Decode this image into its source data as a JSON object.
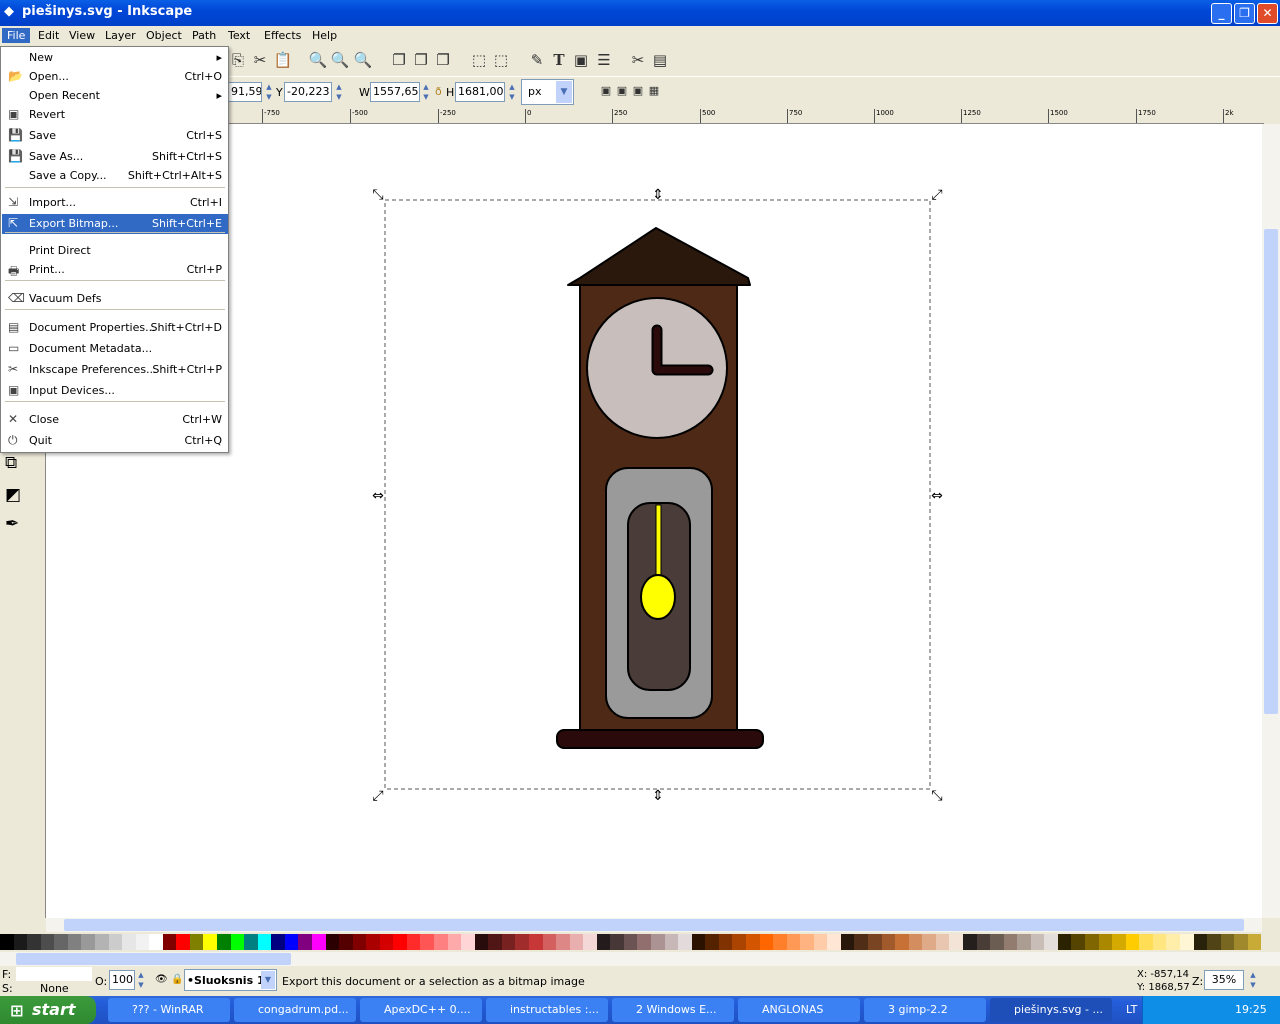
{
  "window": {
    "title": "piešinys.svg - Inkscape",
    "min": "_",
    "max": "❐",
    "close": "✕"
  },
  "menubar": [
    "File",
    "Edit",
    "View",
    "Layer",
    "Object",
    "Path",
    "Text",
    "Effects",
    "Help"
  ],
  "file_menu": [
    {
      "label": "New",
      "shortcut": "",
      "icon": "",
      "submenu": true
    },
    {
      "label": "Open...",
      "shortcut": "Ctrl+O",
      "icon": "folder-icon"
    },
    {
      "label": "Open Recent",
      "shortcut": "",
      "icon": "",
      "submenu": true
    },
    {
      "label": "Revert",
      "shortcut": "",
      "icon": "revert-icon"
    },
    {
      "label": "Save",
      "shortcut": "Ctrl+S",
      "icon": "save-icon"
    },
    {
      "label": "Save As...",
      "shortcut": "Shift+Ctrl+S",
      "icon": "save-as-icon"
    },
    {
      "label": "Save a Copy...",
      "shortcut": "Shift+Ctrl+Alt+S",
      "icon": ""
    },
    {
      "label": "Import...",
      "shortcut": "Ctrl+I",
      "icon": "import-icon"
    },
    {
      "label": "Export Bitmap...",
      "shortcut": "Shift+Ctrl+E",
      "icon": "export-icon",
      "highlighted": true
    },
    {
      "label": "Print Direct",
      "shortcut": "",
      "icon": ""
    },
    {
      "label": "Print...",
      "shortcut": "Ctrl+P",
      "icon": "print-icon"
    },
    {
      "label": "Vacuum Defs",
      "shortcut": "",
      "icon": "vacuum-icon"
    },
    {
      "label": "Document Properties...",
      "shortcut": "Shift+Ctrl+D",
      "icon": "document-properties-icon"
    },
    {
      "label": "Document Metadata...",
      "shortcut": "",
      "icon": "metadata-icon"
    },
    {
      "label": "Inkscape Preferences...",
      "shortcut": "Shift+Ctrl+P",
      "icon": "preferences-icon"
    },
    {
      "label": "Input Devices...",
      "shortcut": "",
      "icon": "input-devices-icon"
    },
    {
      "label": "Close",
      "shortcut": "Ctrl+W",
      "icon": "close-icon"
    },
    {
      "label": "Quit",
      "shortcut": "Ctrl+Q",
      "icon": "quit-icon"
    }
  ],
  "toolcontrols": {
    "x": "91,594",
    "y_label": "Y",
    "y": "-20,223",
    "w_label": "W",
    "w": "1557,655",
    "h_label": "H",
    "h": "1681,003",
    "unit": "px"
  },
  "ruler_ticks": [
    "-750",
    "-500",
    "-250",
    "0",
    "250",
    "500",
    "750",
    "1000",
    "1250",
    "1500",
    "1750",
    "2k"
  ],
  "status": {
    "fill_label": "F:",
    "stroke_label": "S:",
    "stroke_value": "None",
    "opacity_label": "O:",
    "opacity": "100",
    "layer": "•Sluoksnis 1",
    "message": "Export this document or a selection as a bitmap image",
    "cursor_x": "X: -857,14",
    "cursor_y": "Y: 1868,57",
    "zoom_label": "Z:",
    "zoom": "35%"
  },
  "taskbar": {
    "start": "start",
    "tasks": [
      "??? - WinRAR",
      "congadrum.pd...",
      "ApexDC++ 0....",
      "instructables :...",
      "2 Windows E...",
      "ANGLONAS",
      "3 gimp-2.2",
      "piešinys.svg - ..."
    ],
    "lang": "LT",
    "clock": "19:25"
  },
  "drawing_colors": {
    "roof": "#2a180c",
    "body": "#4e2a16",
    "face": "#c8bebb",
    "hands": "#2a0a0a",
    "case": "#9a9a9a",
    "inner": "#4a3c38",
    "pendulum": "#ffff00",
    "base": "#2a0a0a"
  },
  "palette": [
    "#000000",
    "#1a1a1a",
    "#333333",
    "#4d4d4d",
    "#666666",
    "#808080",
    "#999999",
    "#b3b3b3",
    "#cccccc",
    "#e6e6e6",
    "#f2f2f2",
    "#ffffff",
    "#800000",
    "#ff0000",
    "#808000",
    "#ffff00",
    "#008000",
    "#00ff00",
    "#008080",
    "#00ffff",
    "#000080",
    "#0000ff",
    "#800080",
    "#ff00ff",
    "#2b0000",
    "#550000",
    "#800000",
    "#aa0000",
    "#d40000",
    "#ff0000",
    "#ff2a2a",
    "#ff5555",
    "#ff8080",
    "#ffaaaa",
    "#ffd5d5",
    "#280b0b",
    "#501616",
    "#782121",
    "#a02c2c",
    "#c83737",
    "#d35f5f",
    "#de8787",
    "#e9afaf",
    "#f4d7d7",
    "#241c1c",
    "#483737",
    "#6c5353",
    "#916f6f",
    "#ac9393",
    "#c8b7b7",
    "#e3dbdb",
    "#2b1100",
    "#552200",
    "#803300",
    "#aa4400",
    "#d45500",
    "#ff6600",
    "#ff7f2a",
    "#ff9955",
    "#ffb380",
    "#ffccaa",
    "#ffe6d5",
    "#28170b",
    "#502d16",
    "#784421",
    "#a05a2c",
    "#c87137",
    "#d38d5f",
    "#deaa87",
    "#e9c6af",
    "#f4e3d7",
    "#241f1c",
    "#483e37",
    "#6c5d53",
    "#917c6f",
    "#ac9d93",
    "#c8beb7",
    "#e3dedb",
    "#2b2200",
    "#554400",
    "#806600",
    "#aa8800",
    "#d4aa00",
    "#ffcc00",
    "#ffdd55",
    "#ffe680",
    "#ffeeaa",
    "#fff6d5",
    "#28220b",
    "#504416",
    "#786721",
    "#a0892c",
    "#c8ab37"
  ]
}
